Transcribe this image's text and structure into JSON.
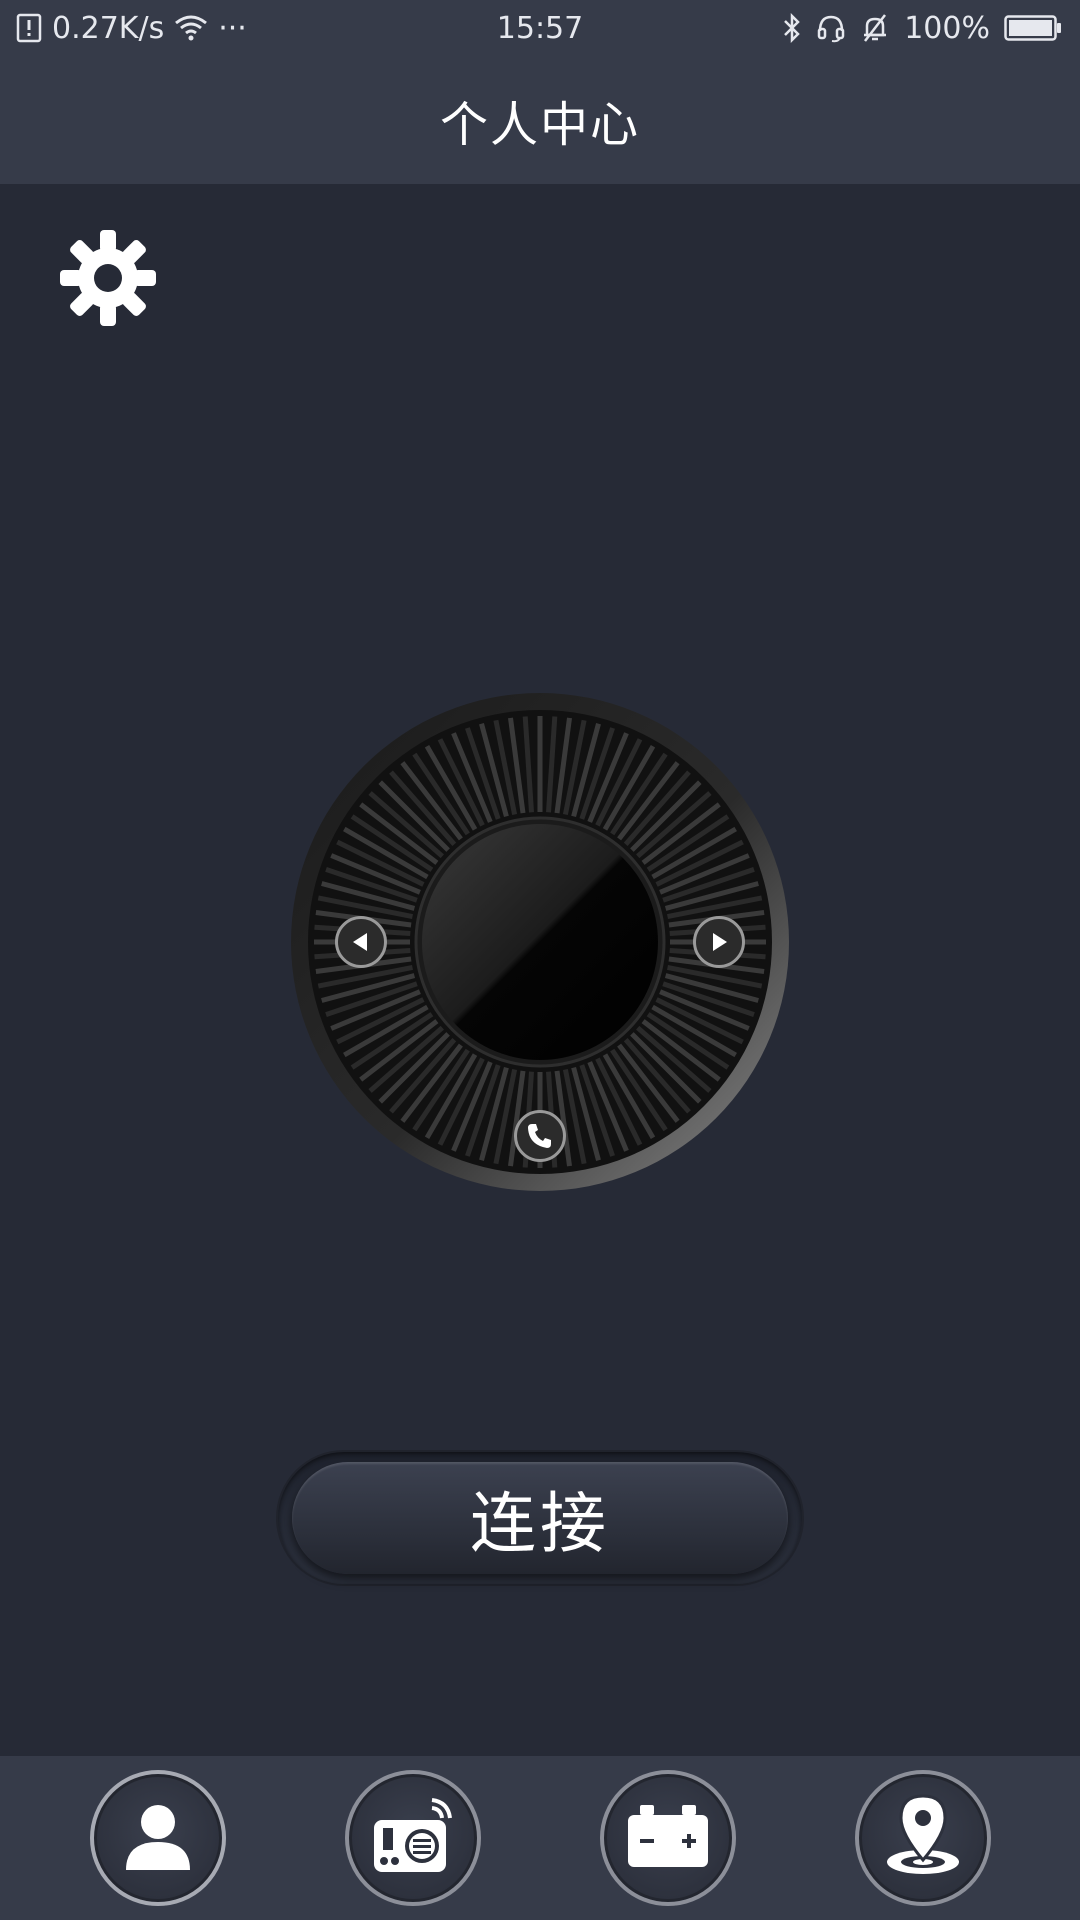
{
  "status_bar": {
    "network_speed": "0.27K/s",
    "more": "···",
    "time": "15:57",
    "battery_percent": "100%"
  },
  "header": {
    "title": "个人中心"
  },
  "main": {
    "connect_label": "连接"
  },
  "icons": {
    "settings": "gear-icon",
    "prev": "triangle-left-icon",
    "next": "triangle-right-icon",
    "call": "phone-icon",
    "nav": [
      "person-icon",
      "radio-icon",
      "battery-car-icon",
      "location-pin-icon"
    ]
  },
  "colors": {
    "background": "#262a36",
    "bar": "#363b49",
    "text": "#ffffff"
  }
}
